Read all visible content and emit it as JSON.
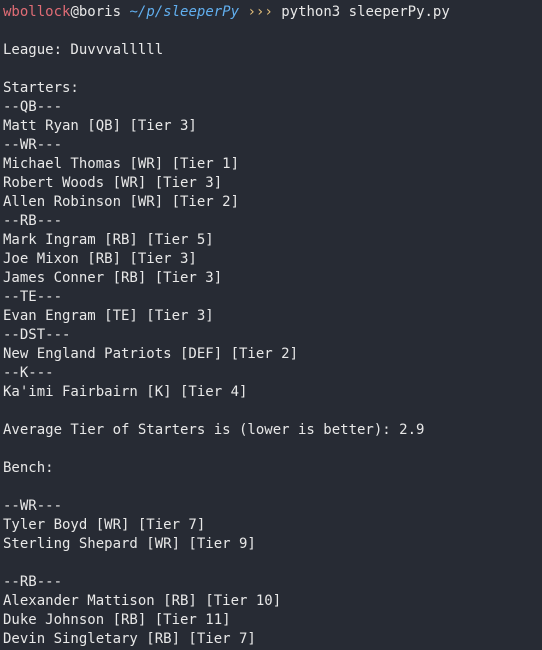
{
  "prompt": {
    "user": "wbollock",
    "at": "@",
    "host": "boris",
    "path": "~/p/sleeperPy",
    "arrows": "›››",
    "command": "python3 sleeperPy.py"
  },
  "output_lines": [
    "",
    "League: Duvvvalllll",
    "",
    "Starters:",
    "--QB---",
    "Matt Ryan [QB] [Tier 3]",
    "--WR---",
    "Michael Thomas [WR] [Tier 1]",
    "Robert Woods [WR] [Tier 3]",
    "Allen Robinson [WR] [Tier 2]",
    "--RB---",
    "Mark Ingram [RB] [Tier 5]",
    "Joe Mixon [RB] [Tier 3]",
    "James Conner [RB] [Tier 3]",
    "--TE---",
    "Evan Engram [TE] [Tier 3]",
    "--DST---",
    "New England Patriots [DEF] [Tier 2]",
    "--K---",
    "Ka'imi Fairbairn [K] [Tier 4]",
    "",
    "Average Tier of Starters is (lower is better): 2.9",
    "",
    "Bench:",
    "",
    "--WR---",
    "Tyler Boyd [WR] [Tier 7]",
    "Sterling Shepard [WR] [Tier 9]",
    "",
    "--RB---",
    "Alexander Mattison [RB] [Tier 10]",
    "Duke Johnson [RB] [Tier 11]",
    "Devin Singletary [RB] [Tier 7]"
  ],
  "colors": {
    "background": "#272b34",
    "text": "#e8e8e8",
    "user": "#e06c75",
    "path": "#61afef",
    "arrows": "#e5c07b"
  }
}
